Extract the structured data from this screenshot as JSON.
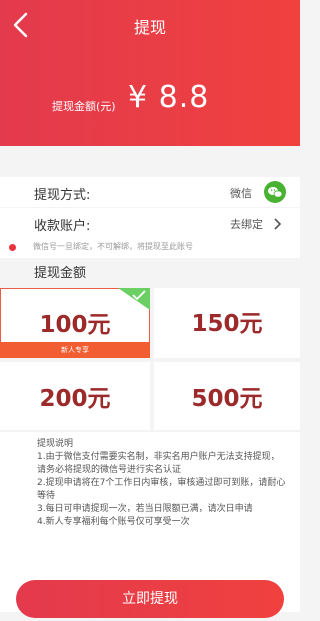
{
  "header": {
    "title": "提现",
    "balance_label": "提现金额(元)",
    "balance_value": "¥ 8.8"
  },
  "method": {
    "label": "提现方式:",
    "value": "微信"
  },
  "account": {
    "label": "收款账户:",
    "value": "去绑定"
  },
  "notice": "微信号一旦绑定，不可解绑，将提现至此账号",
  "amount_label": "提现金额",
  "options": [
    {
      "value": "100元",
      "tag": "新人专享",
      "selected": true
    },
    {
      "value": "150元"
    },
    {
      "value": "200元"
    },
    {
      "value": "500元"
    }
  ],
  "description": {
    "title": "提现说明",
    "lines": [
      "1.由于微信支付需要实名制，非实名用户账户无法支持提现，请务必将提现的微信号进行实名认证",
      "2.提现申请将在7个工作日内审核，审核通过即可到账，请耐心等待",
      "3.每日可申请提现一次，若当日限额已满，请次日申请",
      "4.新人专享福利每个账号仅可享受一次"
    ]
  },
  "submit_label": "立即提现",
  "colors": {
    "accent": "#e8333d",
    "wechat": "#49b233",
    "amount": "#9c2a2a"
  }
}
